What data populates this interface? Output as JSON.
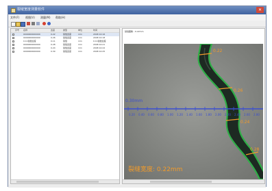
{
  "window": {
    "title": "裂缝宽度测量软件",
    "close_glyph": "✕"
  },
  "menu": [
    "文件(F)",
    "视图(V)",
    "测量(M)",
    "帮助(H)"
  ],
  "toolbar_icons": [
    "new-file-icon",
    "open-icon",
    "save-icon",
    "delete-icon",
    "cut-icon",
    "copy-icon",
    "settings-icon",
    "help-icon"
  ],
  "table": {
    "headers": [
      "序号",
      "名称",
      "宽度",
      "类型",
      "单位",
      "时间"
    ],
    "rows": [
      [
        "1",
        "0000000000000",
        "0.22",
        "裂缝宽度",
        "mm",
        "2008 10:16"
      ],
      [
        "2",
        "0000000000000",
        "0.26",
        "裂缝宽度",
        "mm",
        "2008 10:18"
      ],
      [
        "3",
        "0.11裂缝宽度",
        "0.11",
        "裂缝",
        "mm",
        "0.11裂缝宽度"
      ],
      [
        "4",
        "0000000000000",
        "0.28",
        "裂缝宽度",
        "mm",
        "2008 10:21"
      ],
      [
        "5",
        "0000000000000",
        "0.24",
        "裂缝宽度",
        "mm",
        "2008 10:22"
      ],
      [
        "6",
        "0000000000000",
        "0.30",
        "裂缝宽度",
        "mm",
        "2008 10:25"
      ]
    ]
  },
  "image_panel": {
    "title": "裂缝图像 - 0.22mm",
    "scale_label": "0.30mm",
    "ticks": [
      "0.20",
      "0.40",
      "0.60",
      "0.80",
      "1.00",
      "1.20",
      "1.40",
      "1.60",
      "1.80",
      "2.00",
      "2.20",
      "2.40",
      "2.60",
      "2.80"
    ],
    "measure_label": "裂缝宽度: 0.22mm",
    "crack_labels": [
      "0.22",
      "0.26",
      "0.24",
      "0.28"
    ],
    "colors": {
      "surface": "#8e908c",
      "crack": "#1d2a22",
      "crack_edge": "#2fae47",
      "scale": "#3a4ed0",
      "label": "#f29b2a"
    }
  }
}
